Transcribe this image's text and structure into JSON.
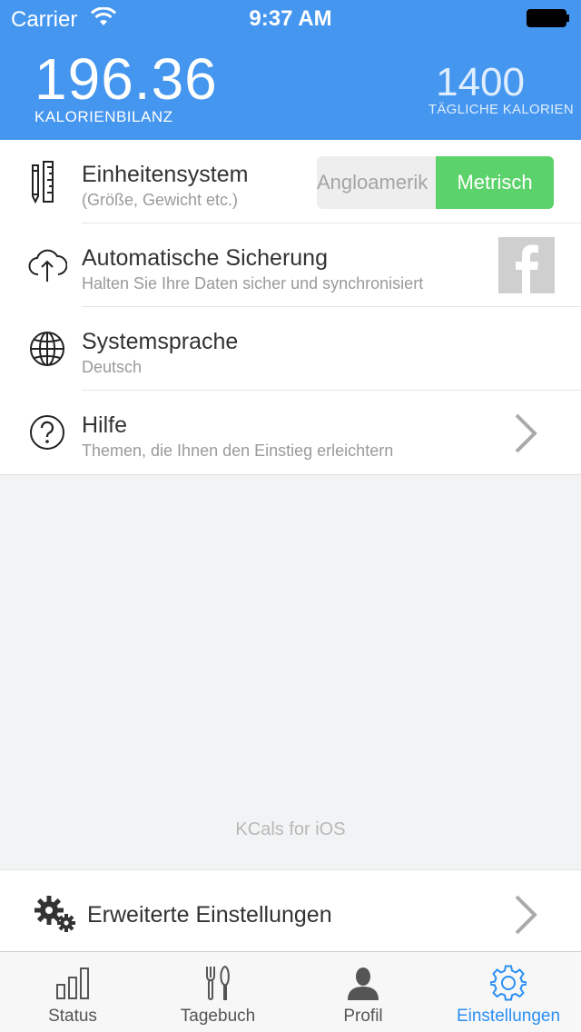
{
  "status_bar": {
    "carrier": "Carrier",
    "time": "9:37 AM"
  },
  "header": {
    "balance_value": "196.36",
    "balance_label": "KALORIENBILANZ",
    "daily_value": "1400",
    "daily_label": "TÄGLICHE KALORIEN"
  },
  "settings": {
    "units": {
      "title": "Einheitensystem",
      "subtitle": "(Größe, Gewicht etc.)",
      "option_imperial": "Angloamerik",
      "option_metric": "Metrisch",
      "selected": "Metrisch"
    },
    "backup": {
      "title": "Automatische Sicherung",
      "subtitle": "Halten Sie Ihre Daten sicher und synchronisiert"
    },
    "language": {
      "title": "Systemsprache",
      "subtitle": "Deutsch"
    },
    "help": {
      "title": "Hilfe",
      "subtitle": "Themen, die Ihnen den Einstieg erleichtern"
    }
  },
  "footer_text": "KCals for iOS",
  "advanced": {
    "title": "Erweiterte Einstellungen"
  },
  "tabs": [
    {
      "label": "Status"
    },
    {
      "label": "Tagebuch"
    },
    {
      "label": "Profil"
    },
    {
      "label": "Einstellungen",
      "active": true
    }
  ],
  "colors": {
    "header": "#4596ef",
    "accent": "#2a8ff5",
    "metric_selected": "#5cd26b"
  }
}
